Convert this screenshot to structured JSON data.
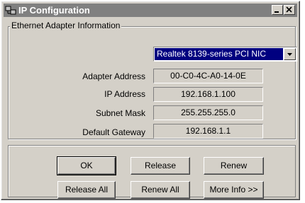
{
  "window": {
    "title": "IP Configuration"
  },
  "group": {
    "label": "Ethernet  Adapter Information",
    "adapter_select": "Realtek 8139-series PCI NIC"
  },
  "rows": [
    {
      "label": "Adapter Address",
      "value": "00-C0-4C-A0-14-0E"
    },
    {
      "label": "IP Address",
      "value": "192.168.1.100"
    },
    {
      "label": "Subnet Mask",
      "value": "255.255.255.0"
    },
    {
      "label": "Default Gateway",
      "value": "192.168.1.1"
    }
  ],
  "buttons": {
    "ok": "OK",
    "release": "Release",
    "renew": "Renew",
    "release_all": "Release All",
    "renew_all": "Renew All",
    "more_info": "More Info >>"
  },
  "colors": {
    "titlebar": "#808080",
    "face": "#d4d0c8",
    "selection": "#000080"
  }
}
